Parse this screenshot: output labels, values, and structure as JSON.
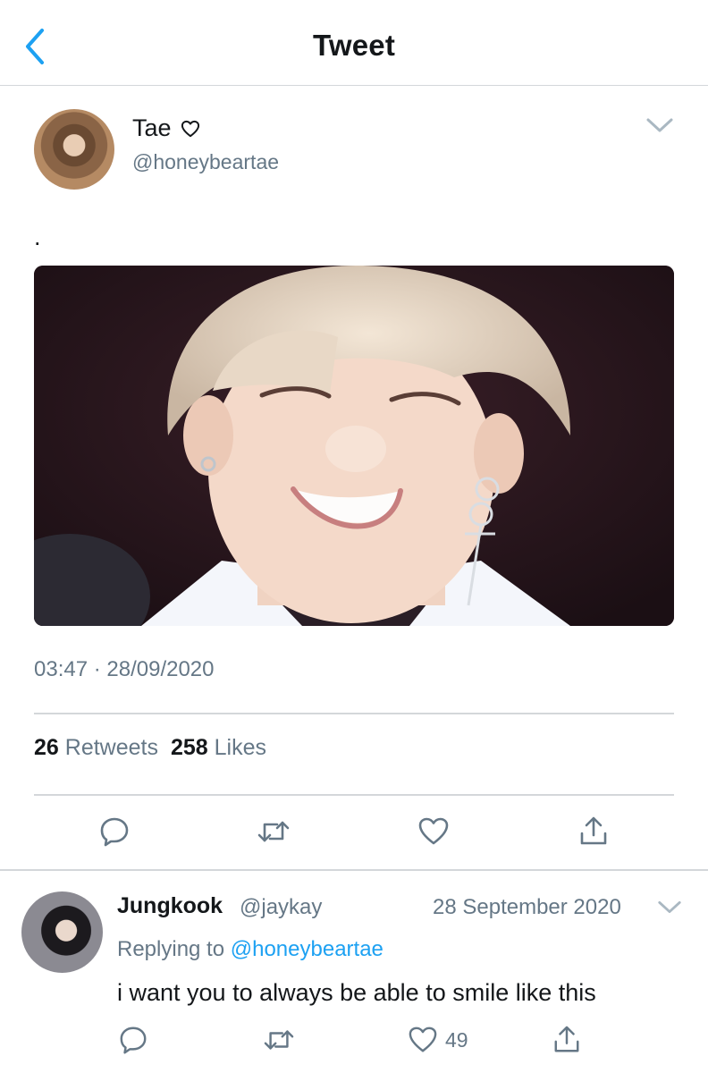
{
  "nav": {
    "title": "Tweet",
    "back_icon": "chevron-left-icon"
  },
  "tweet": {
    "author": {
      "name": "Tae",
      "name_icon": "heart-outline-icon",
      "handle": "@honeybeartae"
    },
    "text": ".",
    "media_description_icon": "photo",
    "timestamp": "03:47 · 28/09/2020",
    "stats": {
      "retweets_count": "26",
      "retweets_label": "Retweets",
      "likes_count": "258",
      "likes_label": "Likes"
    },
    "actions": [
      "reply-icon",
      "retweet-icon",
      "like-icon",
      "share-icon"
    ]
  },
  "reply": {
    "author": {
      "name": "Jungkook",
      "handle": "@jaykay"
    },
    "date": "28 September 2020",
    "replying_prefix": "Replying to",
    "replying_to": "@honeybeartae",
    "text": "i want you to always be able to smile like this",
    "like_count": "49"
  },
  "colors": {
    "accent": "#1da1f2",
    "secondary_text": "#657786",
    "divider": "#d4d7da",
    "text": "#14171a"
  }
}
